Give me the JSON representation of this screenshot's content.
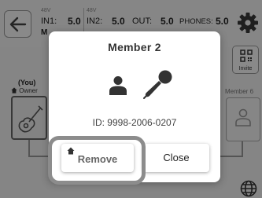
{
  "header": {
    "levels": [
      {
        "phantom": "48V",
        "label": "IN1:",
        "value": "5.0"
      },
      {
        "phantom": "48V",
        "label": "IN2:",
        "value": "5.0"
      },
      {
        "phantom": "",
        "label": "OUT:",
        "value": "5.0"
      },
      {
        "phantom": "",
        "label": "PHONES:",
        "value": "5.0"
      }
    ],
    "truncated_tag": "M"
  },
  "invite": {
    "label": "Invite"
  },
  "owner": {
    "you_label": "(You)",
    "role_label": "Owner"
  },
  "member_slot": {
    "label": "Member 6"
  },
  "modal": {
    "title": "Member 2",
    "id_text": "ID: 9998-2006-0207",
    "remove_label": "Remove",
    "close_label": "Close"
  },
  "icons": [
    "back-arrow-icon",
    "gear-icon",
    "qr-code-icon",
    "guitar-icon",
    "person-icon",
    "microphone-icon",
    "home-icon",
    "globe-icon"
  ],
  "colors": {
    "overlay": "rgba(0,0,0,0.45)",
    "highlight": "#8c8c8c",
    "modal_bg": "#ffffff"
  }
}
